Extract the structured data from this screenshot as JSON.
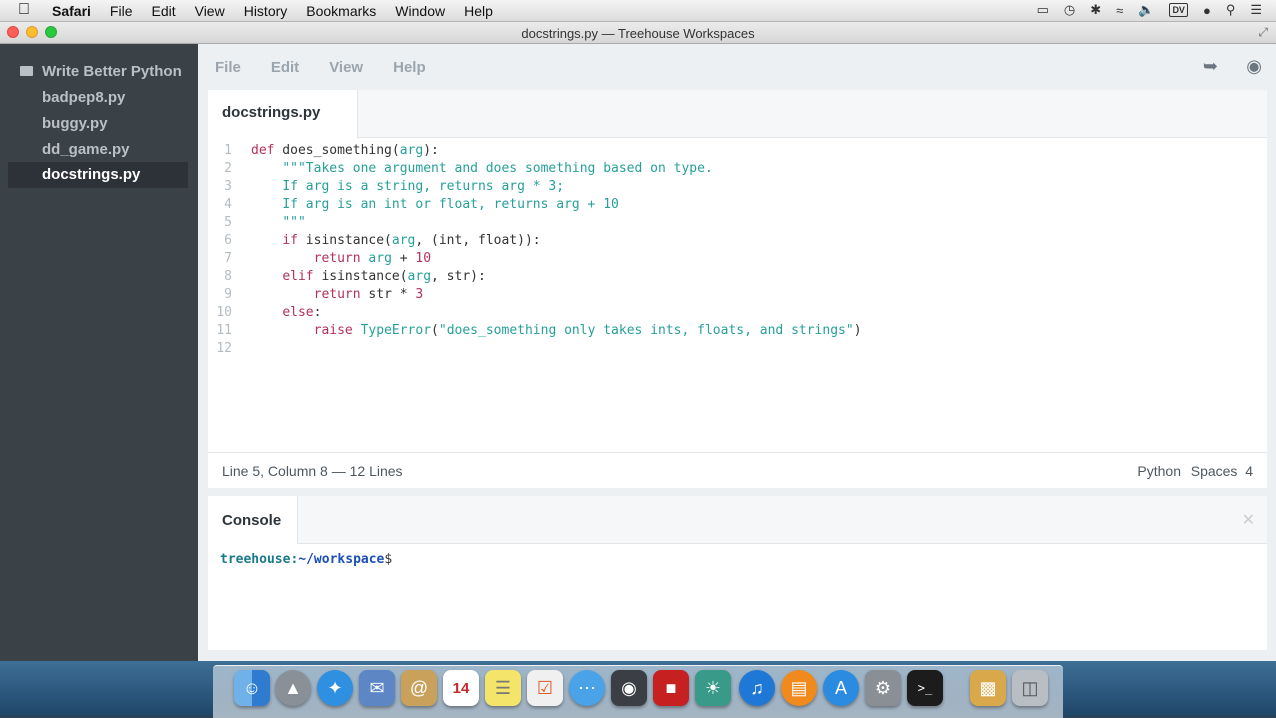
{
  "menubar": {
    "apple": "",
    "app": "Safari",
    "items": [
      "File",
      "Edit",
      "View",
      "History",
      "Bookmarks",
      "Window",
      "Help"
    ],
    "status_icons": [
      "airplay-icon",
      "time-machine-icon",
      "bluetooth-icon",
      "wifi-icon",
      "volume-icon"
    ],
    "input_source": "DV"
  },
  "window": {
    "title": "docstrings.py — Treehouse Workspaces"
  },
  "sidebar": {
    "project": "Write Better Python",
    "files": [
      {
        "name": "badpep8.py"
      },
      {
        "name": "buggy.py"
      },
      {
        "name": "dd_game.py"
      },
      {
        "name": "docstrings.py",
        "active": true
      }
    ]
  },
  "appmenu": [
    "File",
    "Edit",
    "View",
    "Help"
  ],
  "editor": {
    "tab": "docstrings.py",
    "lines": [
      "1",
      "2",
      "3",
      "4",
      "5",
      "6",
      "7",
      "8",
      "9",
      "10",
      "11",
      "12"
    ]
  },
  "code": {
    "l1": {
      "kw": "def",
      "rest": " does_something(",
      "arg": "arg",
      "end": "):"
    },
    "l2": "\"\"\"Takes one argument and does something based on type.",
    "l3": "If arg is a string, returns arg * 3;",
    "l4": "If arg is an int or float, returns arg + 10",
    "l5": "\"\"\"",
    "l6": {
      "kw": "if",
      "a": " isinstance(",
      "arg": "arg",
      "b": ", (int, float)):"
    },
    "l7": {
      "kw": "return",
      "arg": "arg",
      "op": " + ",
      "num": "10"
    },
    "l8": {
      "kw": "elif",
      "a": " isinstance(",
      "arg": "arg",
      "b": ", str):"
    },
    "l9": {
      "kw": "return",
      "a": " str * ",
      "num": "3"
    },
    "l10": {
      "kw": "else",
      "b": ":"
    },
    "l11": {
      "kw": "raise",
      "cls": "TypeError",
      "a": "(",
      "str": "\"does_something only takes ints, floats, and strings\"",
      "b": ")"
    }
  },
  "statusbar": {
    "position": "Line 5, Column 8 — 12 Lines",
    "language": "Python",
    "indent": "Spaces  4"
  },
  "console": {
    "title": "Console",
    "host": "treehouse:",
    "path": "~/workspace",
    "dollar": "$"
  }
}
